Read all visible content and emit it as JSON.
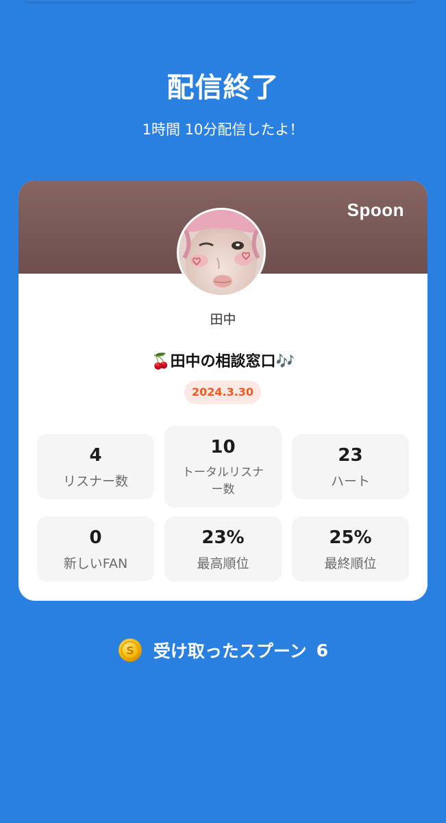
{
  "header": {
    "title": "配信終了",
    "duration_text": "1時間 10分配信したよ！"
  },
  "card": {
    "brand": "Spoon",
    "nickname": "田中",
    "live_title": "🍒田中の相談窓口🎶",
    "date": "2024.3.30",
    "header_color": "#7a5a58",
    "stats": [
      {
        "value": "4",
        "label": "リスナー数"
      },
      {
        "value": "10",
        "label": "トータルリスナー数"
      },
      {
        "value": "23",
        "label": "ハート"
      },
      {
        "value": "0",
        "label": "新しいFAN"
      },
      {
        "value": "23%",
        "label": "最高順位"
      },
      {
        "value": "25%",
        "label": "最終順位"
      }
    ]
  },
  "spoons": {
    "label": "受け取ったスプーン",
    "count": "6",
    "icon": "coin-icon"
  },
  "colors": {
    "background": "#2a80e0",
    "accent_orange": "#ef5a1f",
    "badge_bg": "#fde8e3"
  }
}
